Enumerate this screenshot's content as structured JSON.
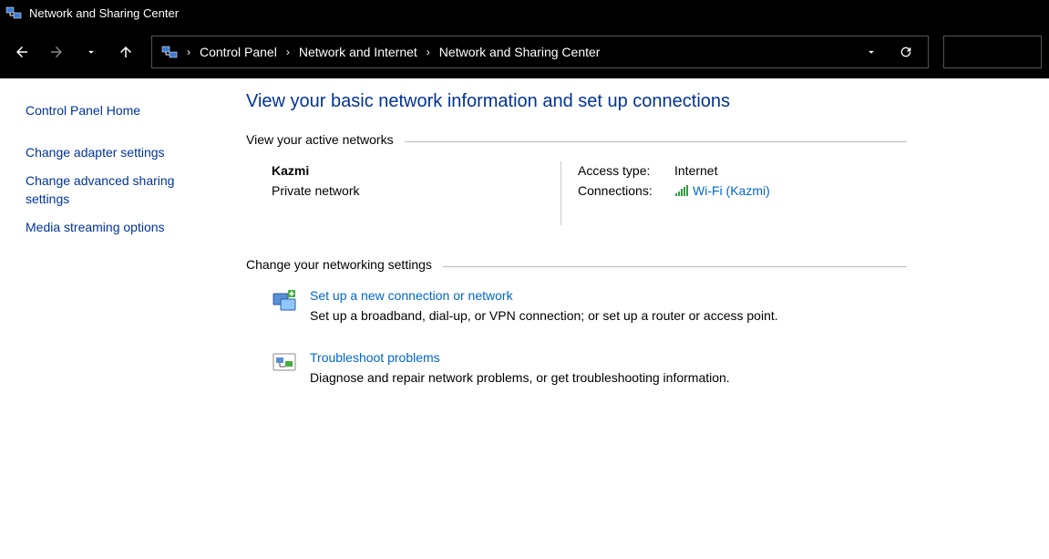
{
  "window": {
    "title": "Network and Sharing Center"
  },
  "breadcrumb": {
    "items": [
      "Control Panel",
      "Network and Internet",
      "Network and Sharing Center"
    ]
  },
  "sidebar": {
    "home": "Control Panel Home",
    "links": [
      "Change adapter settings",
      "Change advanced sharing settings",
      "Media streaming options"
    ]
  },
  "main": {
    "heading": "View your basic network information and set up connections",
    "section1_label": "View your active networks",
    "active_network": {
      "name": "Kazmi",
      "type": "Private network",
      "access_type_label": "Access type:",
      "access_type_value": "Internet",
      "connections_label": "Connections:",
      "connections_value": "Wi-Fi (Kazmi)"
    },
    "section2_label": "Change your networking settings",
    "settings": [
      {
        "link": "Set up a new connection or network",
        "desc": "Set up a broadband, dial-up, or VPN connection; or set up a router or access point."
      },
      {
        "link": "Troubleshoot problems",
        "desc": "Diagnose and repair network problems, or get troubleshooting information."
      }
    ]
  }
}
